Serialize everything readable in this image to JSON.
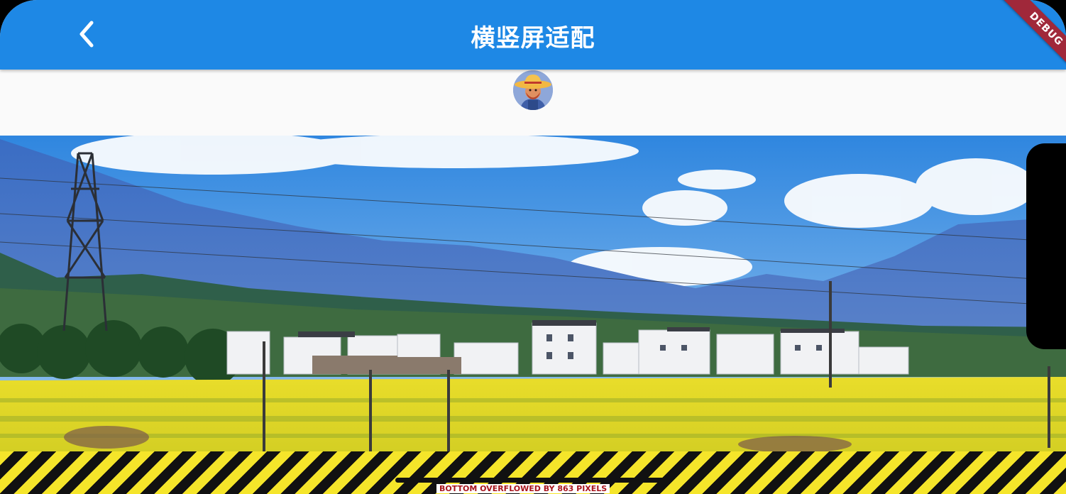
{
  "appbar": {
    "title": "横竖屏适配",
    "back_icon": "chevron-left-icon",
    "color": "#1e88e5"
  },
  "debug_banner": {
    "label": "DEBUG",
    "color": "#a0283a"
  },
  "avatar": {
    "icon": "farmer-avatar"
  },
  "photo": {
    "subject": "landscape-photo",
    "sky_color": "#3d8fe0",
    "field_color": "#f1e72b"
  },
  "overflow_warning": {
    "text": "BOTTOM OVERFLOWED BY 863 PIXELS",
    "color": "#a8161e"
  }
}
